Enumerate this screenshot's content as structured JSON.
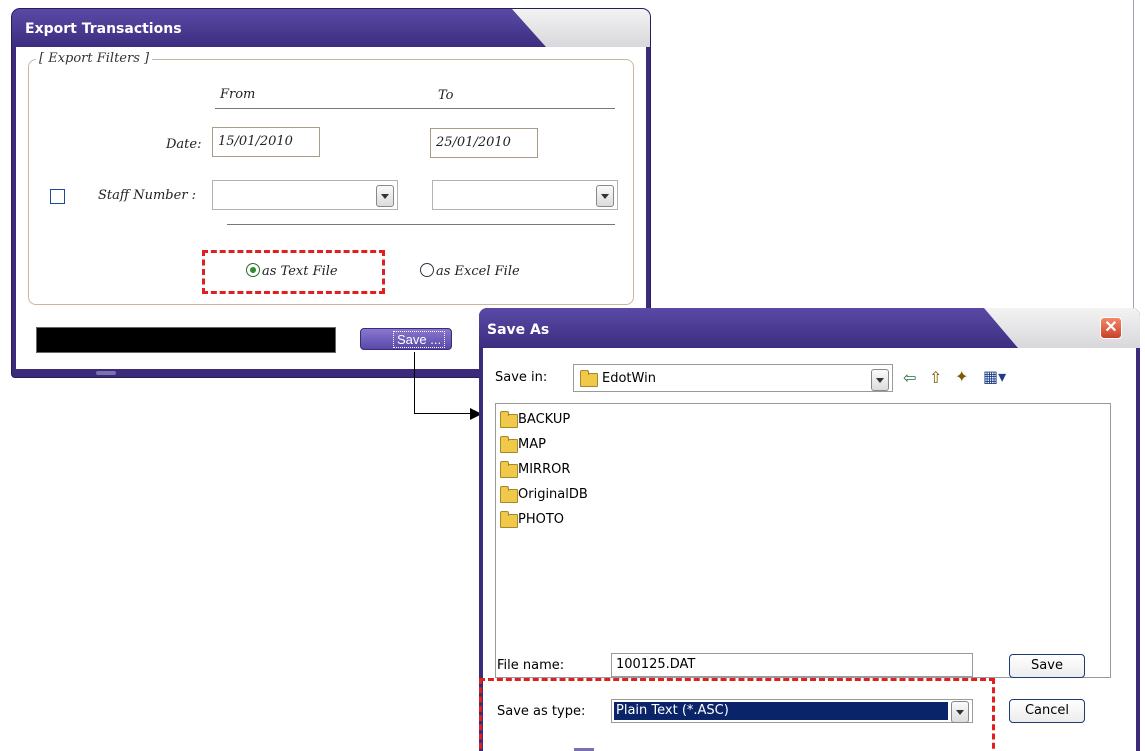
{
  "export_window": {
    "title": "Export Transactions",
    "legend": "[ Export Filters ]",
    "from_label": "From",
    "to_label": "To",
    "date_label": "Date:",
    "date_from": "15/01/2010",
    "date_to": "25/01/2010",
    "staff_label": "Staff Number :",
    "staff_from": "",
    "staff_to": "",
    "staff_checked": false,
    "radio_text": "as Text File",
    "radio_excel": "as Excel File",
    "selected_format": "text",
    "save_button": "Save ..."
  },
  "save_as": {
    "title": "Save As",
    "close_glyph": "✕",
    "save_in_label": "Save in:",
    "current_folder": "EdotWin",
    "folders": [
      "BACKUP",
      "MAP",
      "MIRROR",
      "OriginalDB",
      "PHOTO"
    ],
    "file_name_label": "File name:",
    "file_name_value": "100125.DAT",
    "save_as_type_label": "Save as type:",
    "save_as_type_value": "Plain Text (*.ASC)",
    "save_button": "Save",
    "cancel_button": "Cancel",
    "icons": [
      "back-arrow-icon",
      "up-folder-icon",
      "new-folder-icon",
      "view-menu-icon"
    ]
  },
  "colors": {
    "title_bar": "#3b2b79",
    "highlight": "#e02020",
    "selection": "#0a246a"
  }
}
